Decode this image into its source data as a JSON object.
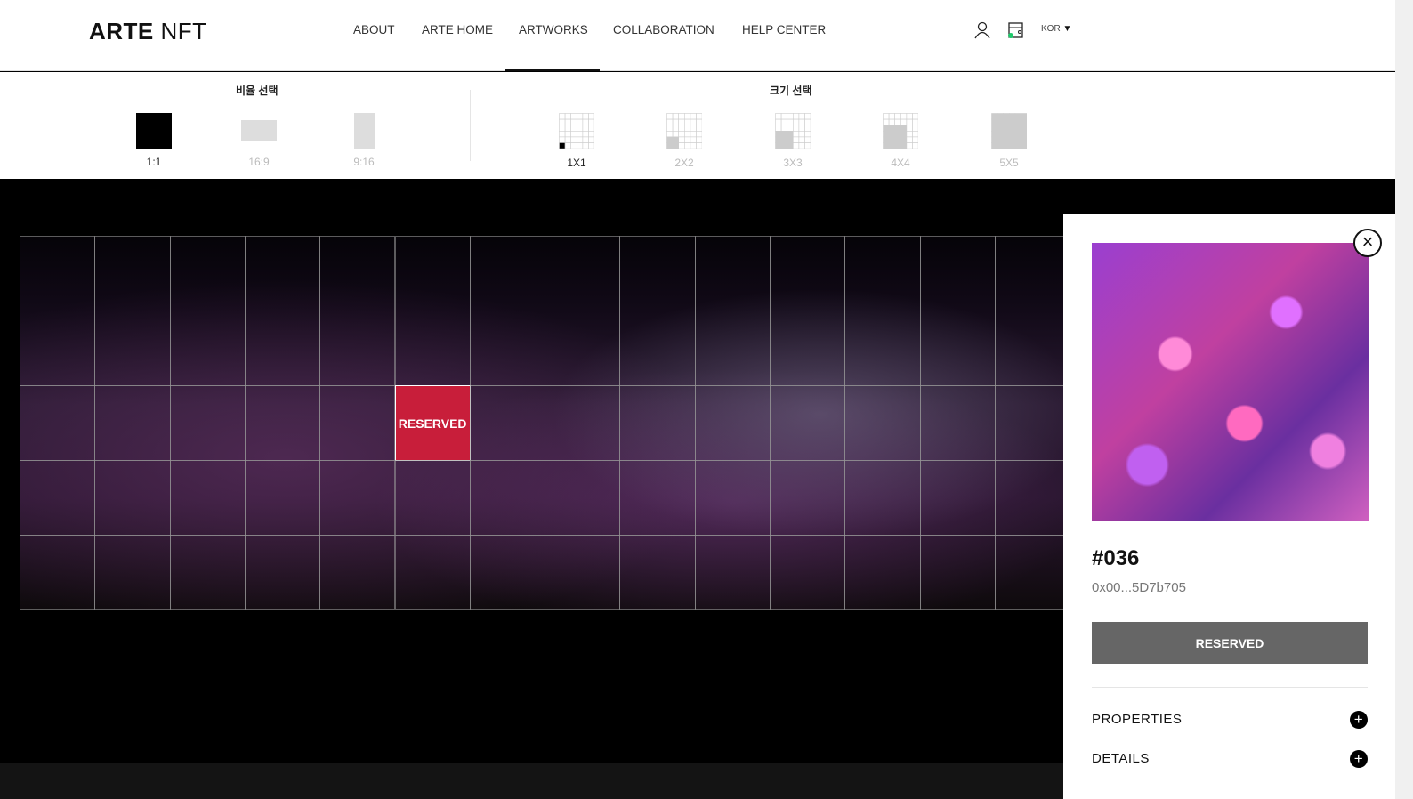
{
  "header": {
    "logo_bold": "ARTE",
    "logo_light": "NFT",
    "nav": [
      "ABOUT",
      "ARTE HOME",
      "ARTWORKS",
      "COLLABORATION",
      "HELP CENTER"
    ],
    "active_nav": "ARTWORKS",
    "language": "KOR"
  },
  "selector": {
    "ratio_title": "비율 선택",
    "ratios": [
      "1:1",
      "16:9",
      "9:16"
    ],
    "selected_ratio": "1:1",
    "size_title": "크기 선택",
    "sizes": [
      "1X1",
      "2X2",
      "3X3",
      "4X4",
      "5X5"
    ],
    "selected_size": "1X1"
  },
  "grid": {
    "columns": 14,
    "rows": 5,
    "reserved_label": "RESERVED",
    "reserved_color": "#c81e3a"
  },
  "panel": {
    "token_id": "#036",
    "address": "0x00...5D7b705",
    "status_button": "RESERVED",
    "sections": [
      "PROPERTIES",
      "DETAILS"
    ]
  }
}
